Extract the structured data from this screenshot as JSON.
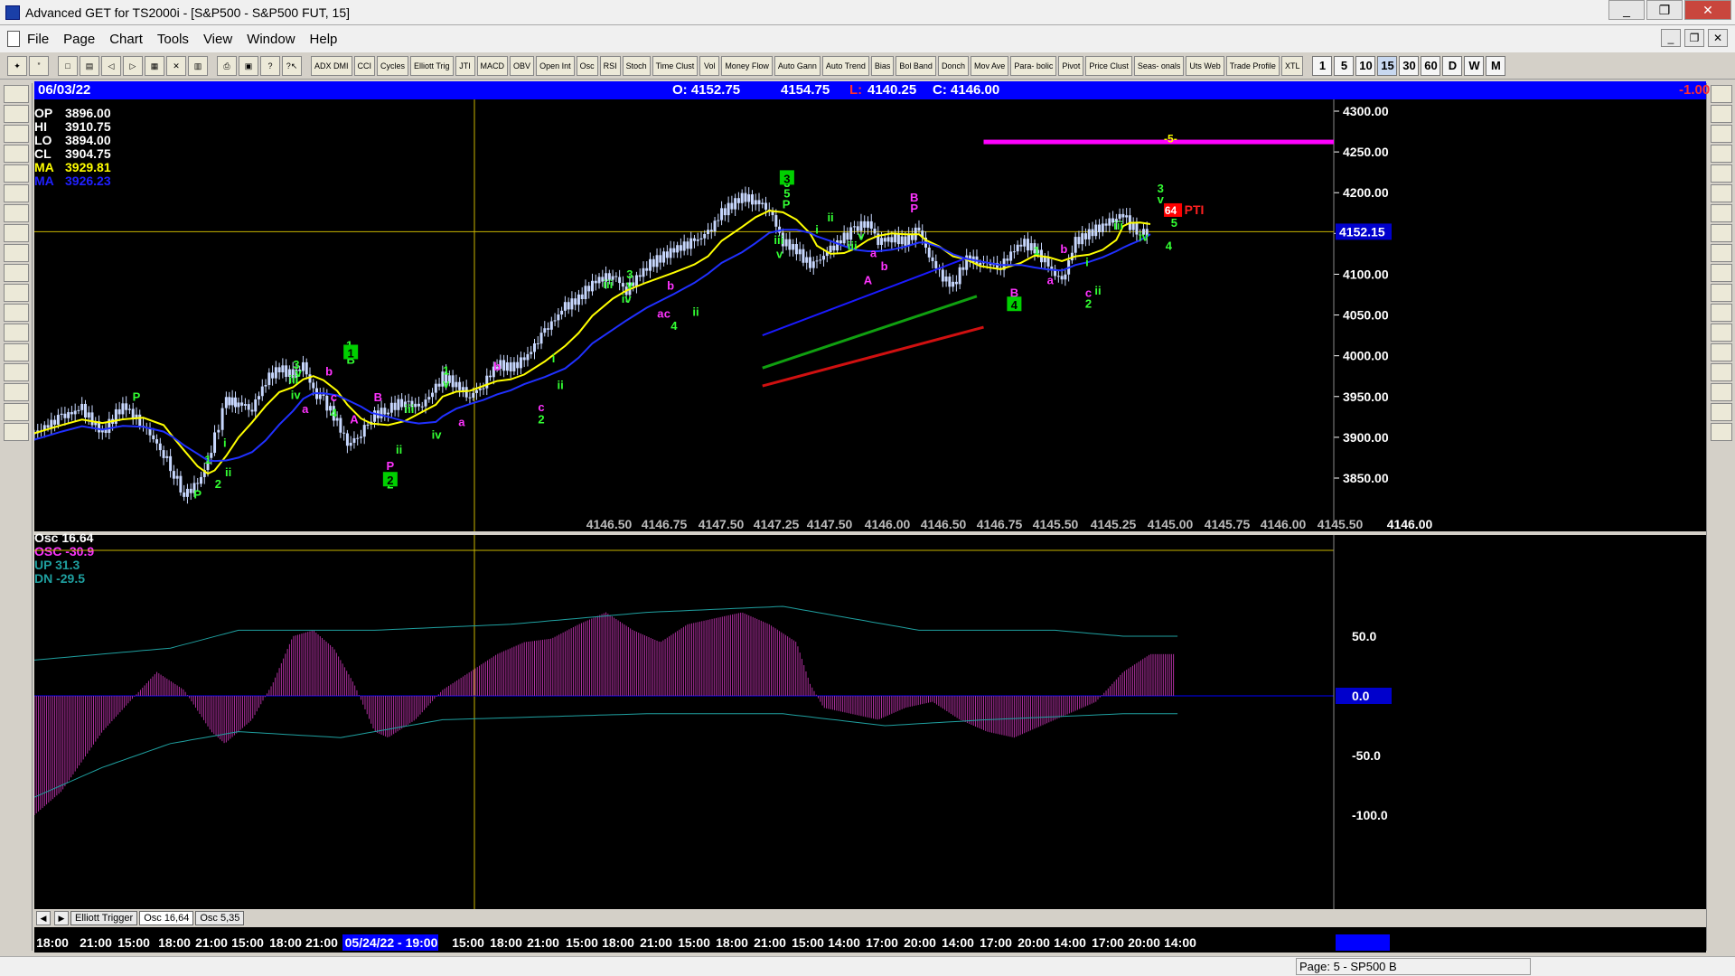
{
  "window": {
    "title": "Advanced GET for TS2000i - [S&P500 - S&P500 FUT, 15]",
    "minimize": "_",
    "maximize": "❐",
    "close": "✕"
  },
  "menu": [
    "File",
    "Page",
    "Chart",
    "Tools",
    "View",
    "Window",
    "Help"
  ],
  "toolbar": {
    "studies": [
      "ADX DMI",
      "CCI",
      "Cycles",
      "Elliott Trig",
      "JTI",
      "MACD",
      "OBV",
      "Open Int",
      "Osc",
      "RSI",
      "Stoch",
      "Time Clust",
      "Vol",
      "Money Flow",
      "Auto Gann",
      "Auto Trend",
      "Bias",
      "Bol Band",
      "Donch",
      "Mov Ave",
      "Para- bolic",
      "Pivot",
      "Price Clust",
      "Seas- onals",
      "Uts Web",
      "Trade Profile",
      "XTL"
    ],
    "intervals": [
      "1",
      "5",
      "10",
      "15",
      "30",
      "60",
      "D",
      "W",
      "M"
    ],
    "active_interval": "15"
  },
  "info": {
    "date": "06/03/22",
    "open": "O: 4152.75",
    "high": "4154.75",
    "low_label": "L:",
    "low": "4140.25",
    "close": "C: 4146.00",
    "change": "-1.00"
  },
  "readout": [
    {
      "label": "OP",
      "value": "3896.00",
      "color": "#ffffff"
    },
    {
      "label": "HI",
      "value": "3910.75",
      "color": "#ffffff"
    },
    {
      "label": "LO",
      "value": "3894.00",
      "color": "#ffffff"
    },
    {
      "label": "CL",
      "value": "3904.75",
      "color": "#ffffff"
    },
    {
      "label": "MA",
      "value": "3929.81",
      "color": "#ffff00"
    },
    {
      "label": "MA",
      "value": "3926.23",
      "color": "#2020ff"
    }
  ],
  "price_axis": [
    "4300.00",
    "4250.00",
    "4200.00",
    "4150.00",
    "4100.00",
    "4050.00",
    "4000.00",
    "3950.00",
    "3900.00",
    "3850.00"
  ],
  "current_price": "4152.15",
  "cursor_prices": [
    "4146.50",
    "4146.75",
    "4147.50",
    "4147.25",
    "4147.50",
    "4146.00",
    "4146.50",
    "4146.75",
    "4145.50",
    "4145.25",
    "4145.00",
    "4145.75",
    "4146.00",
    "4145.50",
    "4146.00"
  ],
  "osc": {
    "title": "Osc 16.64",
    "osc_label": "OSC -30.9",
    "up_label": "UP   31.3",
    "dn_label": "DN   -29.5",
    "axis": [
      "50.0",
      "0.0",
      "-50.0",
      "-100.0"
    ]
  },
  "tabs": [
    "Elliott Trigger",
    "Osc 16,64",
    "Osc 5,35"
  ],
  "active_tab": "Osc 16,64",
  "time_axis": [
    "18:00",
    "21:00",
    "15:00",
    "18:00",
    "21:00",
    "15:00",
    "18:00",
    "21:00",
    "05/24/22 - 19:00",
    "15:00",
    "18:00",
    "21:00",
    "15:00",
    "18:00",
    "21:00",
    "15:00",
    "18:00",
    "21:00",
    "15:00",
    "14:00",
    "17:00",
    "20:00",
    "14:00",
    "17:00",
    "20:00",
    "14:00",
    "17:00",
    "20:00",
    "14:00"
  ],
  "wave_labels": [
    "P",
    "1",
    "2",
    "i",
    "ii",
    "P",
    "3",
    "iii",
    "v",
    "iv",
    "b",
    "a",
    "c",
    "4",
    "1",
    "B",
    "A",
    "B",
    "P",
    "ii",
    "2",
    "iii",
    "iv",
    "1",
    "v",
    "a",
    "b",
    "c",
    "2",
    "i",
    "ii",
    "iii",
    "3",
    "v",
    "iv",
    "b",
    "a",
    "c",
    "4",
    "ii",
    "iii",
    "v",
    "3",
    "5",
    "P",
    "i",
    "ii",
    "iii",
    "v",
    "a",
    "b",
    "A",
    "B",
    "P",
    "1",
    "a",
    "b",
    "4",
    "B",
    "i",
    "c",
    "ii",
    "2",
    "iii",
    "iv",
    "3",
    "v",
    "5",
    "4"
  ],
  "pti": {
    "value": "64",
    "label": "PTI"
  },
  "target": "-5-",
  "status": "Page: 5 - SP500 B"
}
